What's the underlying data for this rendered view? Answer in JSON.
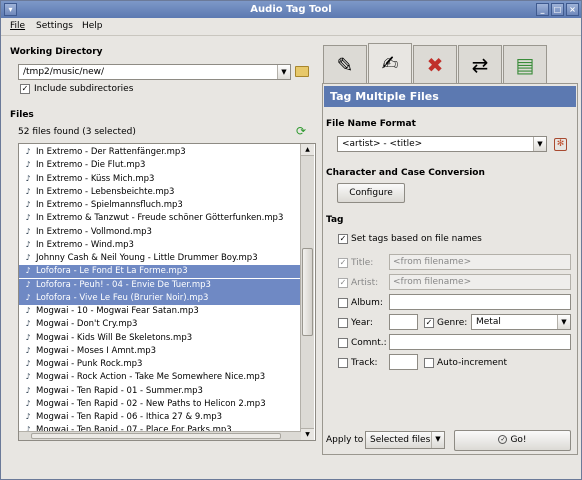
{
  "window": {
    "title": "Audio Tag Tool"
  },
  "menu": [
    "File",
    "Settings",
    "Help"
  ],
  "working_directory": {
    "heading": "Working Directory",
    "path": "/tmp2/music/new/",
    "include_subdirs_label": "Include subdirectories",
    "include_subdirs_checked": true
  },
  "files": {
    "heading": "Files",
    "count_text": "52 files found (3 selected)",
    "rows": [
      {
        "name": "In Extremo - Der Rattenfänger.mp3",
        "selected": false
      },
      {
        "name": "In Extremo - Die Flut.mp3",
        "selected": false
      },
      {
        "name": "In Extremo - Küss Mich.mp3",
        "selected": false
      },
      {
        "name": "In Extremo - Lebensbeichte.mp3",
        "selected": false
      },
      {
        "name": "In Extremo - Spielmannsfluch.mp3",
        "selected": false
      },
      {
        "name": "In Extremo & Tanzwut - Freude schöner Götterfunken.mp3",
        "selected": false
      },
      {
        "name": "In Extremo - Vollmond.mp3",
        "selected": false
      },
      {
        "name": "In Extremo - Wind.mp3",
        "selected": false
      },
      {
        "name": "Johnny Cash & Neil Young - Little Drummer Boy.mp3",
        "selected": false
      },
      {
        "name": "Lofofora - Le Fond Et La Forme.mp3",
        "selected": true
      },
      {
        "name": "Lofofora - Peuh! - 04 - Envie De Tuer.mp3",
        "selected": true
      },
      {
        "name": "Lofofora - Vive Le Feu (Brurier Noir).mp3",
        "selected": true
      },
      {
        "name": "Mogwai - 10 - Mogwai Fear Satan.mp3",
        "selected": false
      },
      {
        "name": "Mogwai - Don't Cry.mp3",
        "selected": false
      },
      {
        "name": "Mogwai - Kids Will Be Skeletons.mp3",
        "selected": false
      },
      {
        "name": "Mogwai - Moses I Amnt.mp3",
        "selected": false
      },
      {
        "name": "Mogwai - Punk Rock.mp3",
        "selected": false
      },
      {
        "name": "Mogwai - Rock Action - Take Me Somewhere Nice.mp3",
        "selected": false
      },
      {
        "name": "Mogwai - Ten Rapid - 01 - Summer.mp3",
        "selected": false
      },
      {
        "name": "Mogwai - Ten Rapid - 02 - New Paths to Helicon 2.mp3",
        "selected": false
      },
      {
        "name": "Mogwai - Ten Rapid - 06 - Ithica 27 & 9.mp3",
        "selected": false
      },
      {
        "name": "Mogwai - Ten Rapid - 07 - Place For Parks.mp3",
        "selected": false
      }
    ]
  },
  "tabs": [
    {
      "icon": "edit-tag-icon"
    },
    {
      "icon": "tag-multiple-icon"
    },
    {
      "icon": "clear-tag-icon"
    },
    {
      "icon": "rename-files-icon"
    },
    {
      "icon": "playlist-icon"
    }
  ],
  "panel": {
    "title": "Tag Multiple Files",
    "filename_format_heading": "File Name Format",
    "filename_format_value": "<artist> - <title>",
    "case_heading": "Character and Case Conversion",
    "configure_label": "Configure",
    "tag_heading": "Tag",
    "set_from_filenames_label": "Set tags based on file names",
    "title_label": "Title:",
    "title_placeholder": "<from filename>",
    "artist_label": "Artist:",
    "artist_placeholder": "<from filename>",
    "album_label": "Album:",
    "album_value": "",
    "year_label": "Year:",
    "year_value": "",
    "genre_label": "Genre:",
    "genre_value": "Metal",
    "comment_label": "Comnt.:",
    "comment_value": "",
    "track_label": "Track:",
    "track_value": "",
    "auto_increment_label": "Auto-increment",
    "apply_to_label": "Apply to",
    "apply_to_value": "Selected files",
    "go_label": "Go!"
  }
}
